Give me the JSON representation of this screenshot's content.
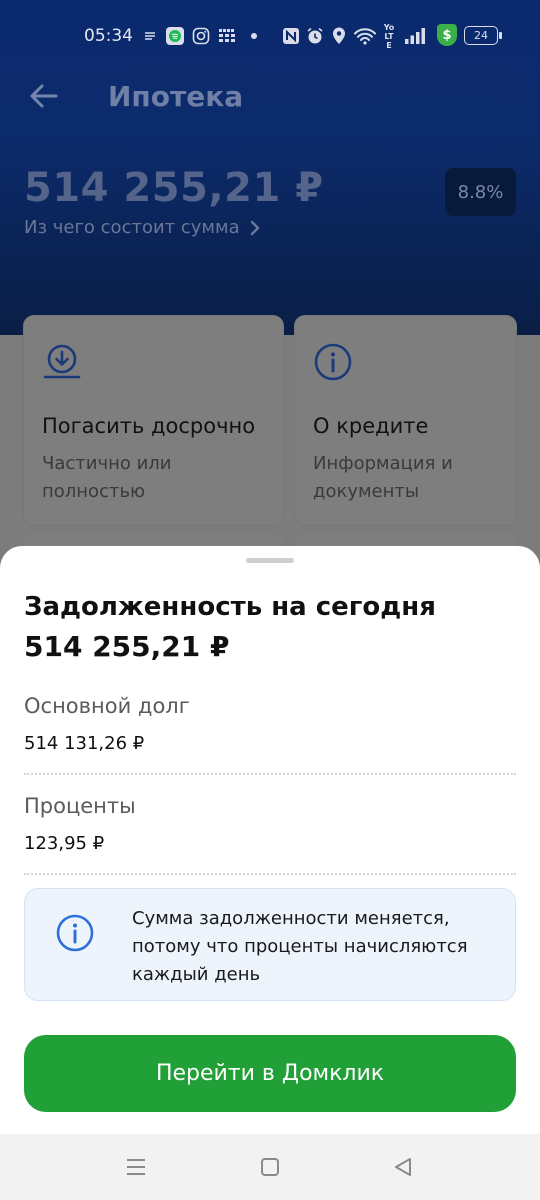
{
  "status_bar": {
    "time": "05:34",
    "battery": "24",
    "network": "Yo LTE",
    "icons": [
      "notes-icon",
      "spotify-icon",
      "instagram-icon",
      "detmir-icon",
      "dot-icon",
      "nfc-icon",
      "alarm-icon",
      "location-icon",
      "wifi-icon",
      "signal-icon",
      "shield-icon",
      "battery-icon"
    ]
  },
  "header": {
    "title": "Ипотека",
    "amount": "514 255,21 ₽",
    "composition_link": "Из чего состоит сумма",
    "rate": "8.8%"
  },
  "cards": [
    {
      "title": "Погасить досрочно",
      "subtitle": "Частично или полностью",
      "icon": "download-icon"
    },
    {
      "title": "О кредите",
      "subtitle": "Информация и документы",
      "icon": "info-icon"
    }
  ],
  "sheet": {
    "title": "Задолженность на сегодня",
    "total": "514 255,21 ₽",
    "principal_label": "Основной долг",
    "principal_value": "514 131,26 ₽",
    "interest_label": "Проценты",
    "interest_value": "123,95 ₽",
    "info_text": "Сумма задолженности меняется, потому что проценты начисляются каждый день",
    "cta": "Перейти в Домклик"
  },
  "colors": {
    "header_top": "#0b2a6e",
    "accent_green": "#21a038",
    "info_bg": "#eef4fc",
    "info_icon": "#2e6fd8"
  }
}
